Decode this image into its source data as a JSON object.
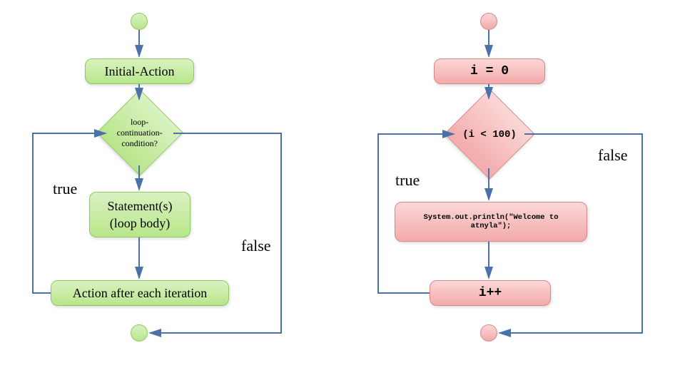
{
  "diagram": {
    "colors": {
      "green": "#c5e8a0",
      "red": "#f3b3b3",
      "arrow": "#4a72a8"
    },
    "left": {
      "init_action": "Initial-Action",
      "condition_l1": "loop-",
      "condition_l2": "continuation-",
      "condition_l3": "condition?",
      "body_l1": "Statement(s)",
      "body_l2": "(loop body)",
      "after": "Action after each iteration",
      "true_label": "true",
      "false_label": "false"
    },
    "right": {
      "init": "i = 0",
      "condition": "(i < 100)",
      "body": "System.out.println(\"Welcome to atnyla\");",
      "increment": "i++",
      "true_label": "true",
      "false_label": "false"
    }
  }
}
